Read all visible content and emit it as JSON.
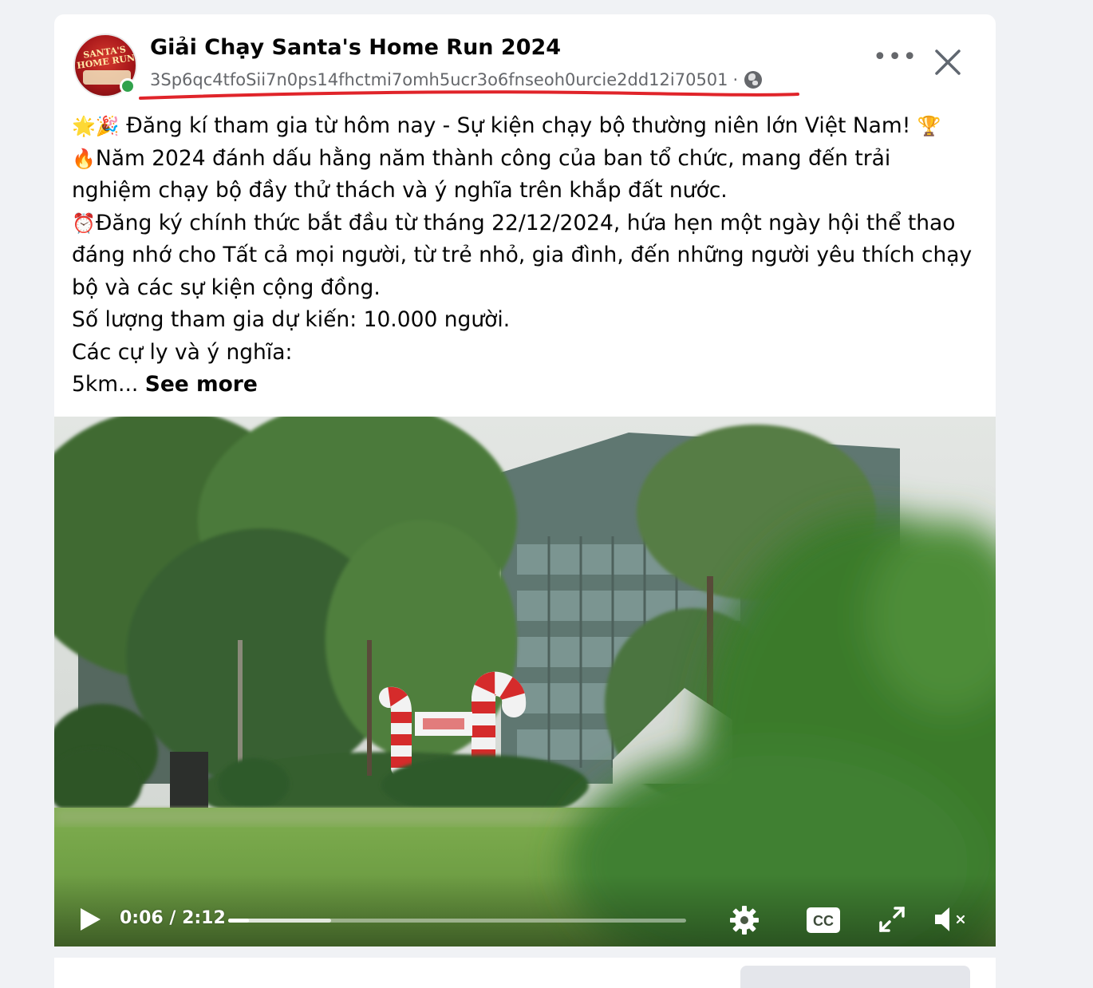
{
  "post": {
    "page_name": "Giải Chạy Santa's Home Run 2024",
    "page_id": "3Sp6qc4tfoSii7n0ps14fhctmi7omh5ucr3o6fnseoh0urcie2dd12i70501",
    "meta_separator": "·",
    "avatar_text": "SANTA'S HOME RUN",
    "icons": {
      "privacy": "globe-icon",
      "more": "more-options-icon",
      "close": "close-icon"
    },
    "text_lines": [
      "Đăng kí tham gia từ hôm nay - Sự kiện chạy bộ thường niên lớn Việt Nam!",
      "Năm 2024 đánh dấu hằng năm thành công của ban tổ chức, mang đến trải",
      "nghiệm chạy bộ đầy thử thách và ý nghĩa trên khắp đất nước.",
      "Đăng ký chính thức bắt đầu từ tháng 22/12/2024, hứa hẹn một ngày hội thể thao",
      "đáng nhớ cho Tất cả mọi người, từ trẻ nhỏ, gia đình, đến những người yêu thích chạy",
      "bộ và các sự kiện cộng đồng.",
      "Số lượng tham gia dự kiến: 10.000 người.",
      "Các cự ly và ý nghĩa:",
      "5km..."
    ],
    "emoji": {
      "sparkle": "🌟",
      "party": "🎉",
      "trophy": "🏆",
      "fire": "🔥",
      "alarm": "⏰"
    },
    "see_more_label": "See more",
    "accent_colors": {
      "underline": "#e0242a",
      "online": "#31a24c"
    }
  },
  "video": {
    "current_time": "0:06",
    "duration": "2:12",
    "time_display": "0:06 / 2:12",
    "progress": 0.046,
    "buffered": 0.225,
    "controls": [
      "play-icon",
      "settings-icon",
      "cc-icon",
      "fullscreen-icon",
      "mute-icon"
    ],
    "cc_label": "CC"
  }
}
